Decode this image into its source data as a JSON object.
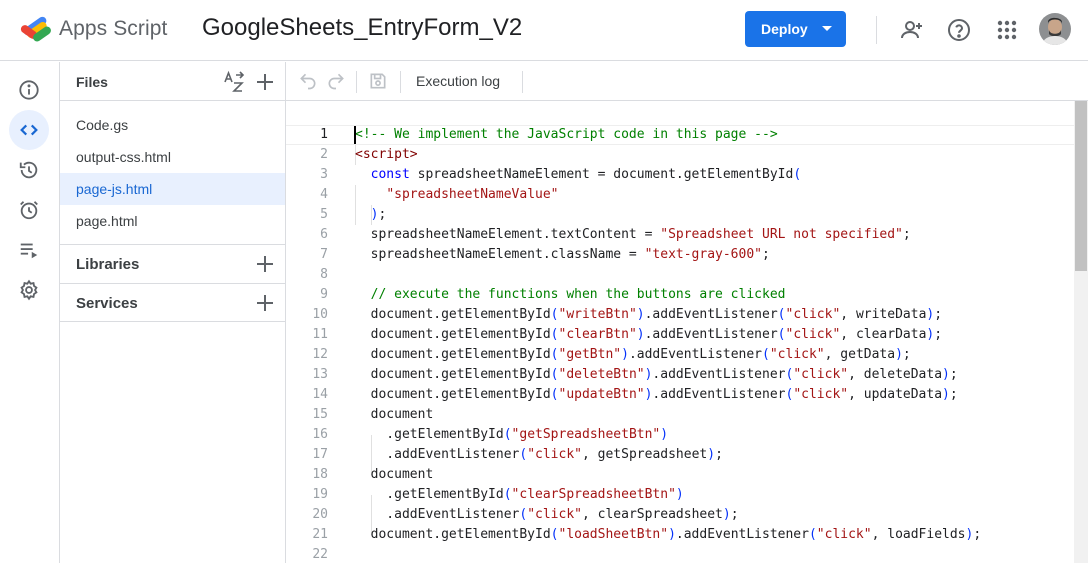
{
  "header": {
    "app_name": "Apps Script",
    "project_title": "GoogleSheets_EntryForm_V2",
    "deploy_label": "Deploy",
    "icons": [
      "add-person-icon",
      "help-icon",
      "apps-grid-icon"
    ]
  },
  "rail": {
    "items": [
      {
        "name": "overview",
        "icon": "info-icon"
      },
      {
        "name": "editor",
        "icon": "code-icon",
        "active": true
      },
      {
        "name": "project-history",
        "icon": "history-icon"
      },
      {
        "name": "triggers",
        "icon": "alarm-icon"
      },
      {
        "name": "executions",
        "icon": "executions-icon"
      },
      {
        "name": "settings",
        "icon": "gear-icon"
      }
    ]
  },
  "files": {
    "title": "Files",
    "items": [
      {
        "label": "Code.gs"
      },
      {
        "label": "output-css.html"
      },
      {
        "label": "page-js.html",
        "active": true
      },
      {
        "label": "page.html"
      }
    ],
    "libraries_label": "Libraries",
    "services_label": "Services"
  },
  "toolbar": {
    "execution_log_label": "Execution log"
  },
  "editor": {
    "current_line": 1,
    "lines": [
      {
        "n": "1"
      },
      {
        "n": "2"
      },
      {
        "n": "3"
      },
      {
        "n": "4"
      },
      {
        "n": "5"
      },
      {
        "n": "6"
      },
      {
        "n": "7"
      },
      {
        "n": "8"
      },
      {
        "n": "9"
      },
      {
        "n": "10"
      },
      {
        "n": "11"
      },
      {
        "n": "12"
      },
      {
        "n": "13"
      },
      {
        "n": "14"
      },
      {
        "n": "15"
      },
      {
        "n": "16"
      },
      {
        "n": "17"
      },
      {
        "n": "18"
      },
      {
        "n": "19"
      },
      {
        "n": "20"
      },
      {
        "n": "21"
      },
      {
        "n": "22"
      }
    ],
    "code": [
      [
        [
          "c-comment",
          "<!-- We implement the JavaScript code in this page -->"
        ]
      ],
      [
        [
          "c-tag",
          "<script>"
        ]
      ],
      [
        [
          "",
          "  "
        ],
        [
          "c-kw",
          "const"
        ],
        [
          "",
          " spreadsheetNameElement = document.getElementById"
        ],
        [
          "c-br",
          "("
        ]
      ],
      [
        [
          "",
          "    "
        ],
        [
          "c-str",
          "\"spreadsheetNameValue\""
        ]
      ],
      [
        [
          "",
          "  "
        ],
        [
          "c-br",
          ")"
        ],
        [
          "",
          ";"
        ]
      ],
      [
        [
          "",
          "  spreadsheetNameElement.textContent = "
        ],
        [
          "c-str",
          "\"Spreadsheet URL not specified\""
        ],
        [
          "",
          ";"
        ]
      ],
      [
        [
          "",
          "  spreadsheetNameElement.className = "
        ],
        [
          "c-str",
          "\"text-gray-600\""
        ],
        [
          "",
          ";"
        ]
      ],
      [
        [
          "",
          ""
        ]
      ],
      [
        [
          "",
          "  "
        ],
        [
          "c-comment",
          "// execute the functions when the buttons are clicked"
        ]
      ],
      [
        [
          "",
          "  document.getElementById"
        ],
        [
          "c-br",
          "("
        ],
        [
          "c-str",
          "\"writeBtn\""
        ],
        [
          "c-br",
          ")"
        ],
        [
          "",
          ".addEventListener"
        ],
        [
          "c-br",
          "("
        ],
        [
          "c-str",
          "\"click\""
        ],
        [
          "",
          ", writeData"
        ],
        [
          "c-br",
          ")"
        ],
        [
          "",
          ";"
        ]
      ],
      [
        [
          "",
          "  document.getElementById"
        ],
        [
          "c-br",
          "("
        ],
        [
          "c-str",
          "\"clearBtn\""
        ],
        [
          "c-br",
          ")"
        ],
        [
          "",
          ".addEventListener"
        ],
        [
          "c-br",
          "("
        ],
        [
          "c-str",
          "\"click\""
        ],
        [
          "",
          ", clearData"
        ],
        [
          "c-br",
          ")"
        ],
        [
          "",
          ";"
        ]
      ],
      [
        [
          "",
          "  document.getElementById"
        ],
        [
          "c-br",
          "("
        ],
        [
          "c-str",
          "\"getBtn\""
        ],
        [
          "c-br",
          ")"
        ],
        [
          "",
          ".addEventListener"
        ],
        [
          "c-br",
          "("
        ],
        [
          "c-str",
          "\"click\""
        ],
        [
          "",
          ", getData"
        ],
        [
          "c-br",
          ")"
        ],
        [
          "",
          ";"
        ]
      ],
      [
        [
          "",
          "  document.getElementById"
        ],
        [
          "c-br",
          "("
        ],
        [
          "c-str",
          "\"deleteBtn\""
        ],
        [
          "c-br",
          ")"
        ],
        [
          "",
          ".addEventListener"
        ],
        [
          "c-br",
          "("
        ],
        [
          "c-str",
          "\"click\""
        ],
        [
          "",
          ", deleteData"
        ],
        [
          "c-br",
          ")"
        ],
        [
          "",
          ";"
        ]
      ],
      [
        [
          "",
          "  document.getElementById"
        ],
        [
          "c-br",
          "("
        ],
        [
          "c-str",
          "\"updateBtn\""
        ],
        [
          "c-br",
          ")"
        ],
        [
          "",
          ".addEventListener"
        ],
        [
          "c-br",
          "("
        ],
        [
          "c-str",
          "\"click\""
        ],
        [
          "",
          ", updateData"
        ],
        [
          "c-br",
          ")"
        ],
        [
          "",
          ";"
        ]
      ],
      [
        [
          "",
          "  document"
        ]
      ],
      [
        [
          "",
          "    .getElementById"
        ],
        [
          "c-br",
          "("
        ],
        [
          "c-str",
          "\"getSpreadsheetBtn\""
        ],
        [
          "c-br",
          ")"
        ]
      ],
      [
        [
          "",
          "    .addEventListener"
        ],
        [
          "c-br",
          "("
        ],
        [
          "c-str",
          "\"click\""
        ],
        [
          "",
          ", getSpreadsheet"
        ],
        [
          "c-br",
          ")"
        ],
        [
          "",
          ";"
        ]
      ],
      [
        [
          "",
          "  document"
        ]
      ],
      [
        [
          "",
          "    .getElementById"
        ],
        [
          "c-br",
          "("
        ],
        [
          "c-str",
          "\"clearSpreadsheetBtn\""
        ],
        [
          "c-br",
          ")"
        ]
      ],
      [
        [
          "",
          "    .addEventListener"
        ],
        [
          "c-br",
          "("
        ],
        [
          "c-str",
          "\"click\""
        ],
        [
          "",
          ", clearSpreadsheet"
        ],
        [
          "c-br",
          ")"
        ],
        [
          "",
          ";"
        ]
      ],
      [
        [
          "",
          "  document.getElementById"
        ],
        [
          "c-br",
          "("
        ],
        [
          "c-str",
          "\"loadSheetBtn\""
        ],
        [
          "c-br",
          ")"
        ],
        [
          "",
          ".addEventListener"
        ],
        [
          "c-br",
          "("
        ],
        [
          "c-str",
          "\"click\""
        ],
        [
          "",
          ", loadFields"
        ],
        [
          "c-br",
          ")"
        ],
        [
          "",
          ";"
        ]
      ],
      [
        [
          "",
          ""
        ]
      ]
    ]
  },
  "colors": {
    "accent": "#1a73e8",
    "active_bg": "#e8f0fe",
    "active_text": "#1967d2",
    "comment": "#008000",
    "string": "#a31515",
    "keyword": "#0000ff",
    "tag": "#800000"
  }
}
